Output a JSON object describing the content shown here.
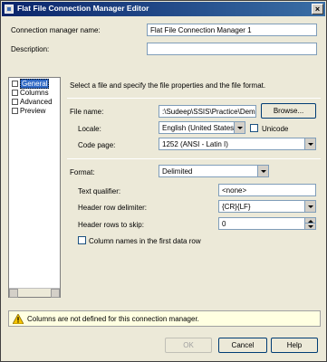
{
  "window": {
    "title": "Flat File Connection Manager Editor",
    "close_glyph": "×"
  },
  "form": {
    "connection_manager_name_label": "Connection manager name:",
    "connection_manager_name_value": "Flat File Connection Manager 1",
    "description_label": "Description:",
    "description_value": ""
  },
  "nav": {
    "items": [
      {
        "label": "General",
        "selected": true
      },
      {
        "label": "Columns",
        "selected": false
      },
      {
        "label": "Advanced",
        "selected": false
      },
      {
        "label": "Preview",
        "selected": false
      }
    ]
  },
  "general": {
    "instruction": "Select a file and specify the file properties and the file format.",
    "file_name_label": "File name:",
    "file_name_value": ":\\Sudeep\\SSIS\\Practice\\Demo.txt",
    "browse_label": "Browse...",
    "locale_label": "Locale:",
    "locale_value": "English (United States)",
    "unicode_label": "Unicode",
    "code_page_label": "Code page:",
    "code_page_value": "1252  (ANSI - Latin I)",
    "format_label": "Format:",
    "format_value": "Delimited",
    "text_qualifier_label": "Text qualifier:",
    "text_qualifier_value": "<none>",
    "header_row_delimiter_label": "Header row delimiter:",
    "header_row_delimiter_value": "{CR}{LF}",
    "header_rows_to_skip_label": "Header rows to skip:",
    "header_rows_to_skip_value": "0",
    "column_names_label": "Column names in the first data row"
  },
  "warning": {
    "text": "Columns are not defined for this connection manager."
  },
  "buttons": {
    "ok": "OK",
    "cancel": "Cancel",
    "help": "Help"
  }
}
